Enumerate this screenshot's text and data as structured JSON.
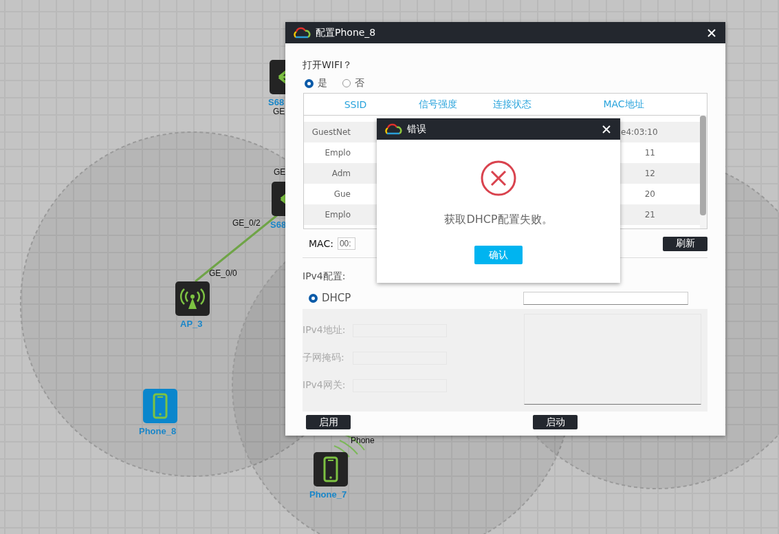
{
  "canvas": {
    "nodes": [
      {
        "kind": "switch",
        "label": "S68",
        "selected": false
      },
      {
        "kind": "switch",
        "label": "S68",
        "selected": false
      },
      {
        "kind": "ap",
        "label": "AP_3",
        "selected": false
      },
      {
        "kind": "phone",
        "label": "Phone_8",
        "selected": true
      },
      {
        "kind": "phone",
        "label": "Phone_7",
        "selected": false
      }
    ],
    "port_labels": [
      "GE",
      "GE",
      "GE_0/2",
      "GE_0/0",
      "Phone"
    ]
  },
  "config_dialog": {
    "title": "配置Phone_8",
    "wifi_question": "打开WIFI？",
    "wifi_options": [
      {
        "label": "是",
        "selected": true
      },
      {
        "label": "否",
        "selected": false
      }
    ],
    "wifi_table": {
      "columns": [
        "SSID",
        "信号强度",
        "连接状态",
        "MAC地址"
      ],
      "rows": [
        {
          "ssid": "GuestNet",
          "mac": "e4:03:10"
        },
        {
          "ssid": "Emplo",
          "mac": "11"
        },
        {
          "ssid": "Adm",
          "mac": "12"
        },
        {
          "ssid": "Gue",
          "mac": "20"
        },
        {
          "ssid": "Emplo",
          "mac": "21"
        }
      ]
    },
    "mac_label": "MAC:",
    "mac_value": "00:",
    "refresh_button": "刷新",
    "ipv4_heading": "IPv4配置:",
    "dhcp_option": {
      "label": "DHCP",
      "selected": true
    },
    "static_fields": [
      {
        "label": "IPv4地址:",
        "disabled": true
      },
      {
        "label": "子网掩码:",
        "disabled": true
      },
      {
        "label": "IPv4网关:",
        "disabled": true
      }
    ],
    "apply_button": "启用",
    "start_button": "启动"
  },
  "error_dialog": {
    "title": "错误",
    "message": "获取DHCP配置失败。",
    "confirm_button": "确认"
  }
}
